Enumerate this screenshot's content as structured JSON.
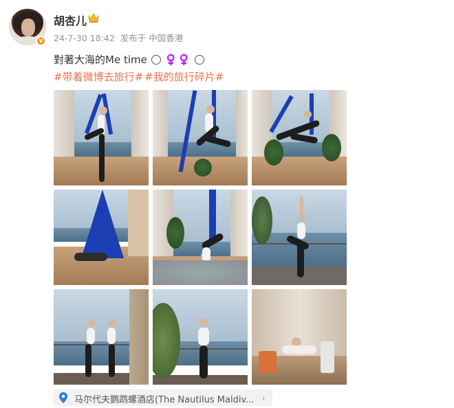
{
  "user": {
    "name": "胡杏儿",
    "timestamp": "24-7-30 18:42",
    "source": "发布于 中国香港",
    "verified_color": "#f7931e"
  },
  "post": {
    "text": "對著大海的Me time",
    "text_suffix": "♀️♀️",
    "hashtags": [
      "#带着微博去旅行#",
      "#我的旅行碎片#"
    ],
    "hashtag_color": "#eb7350"
  },
  "photos": [
    {
      "label": ""
    },
    {
      "label": ""
    },
    {
      "label": ""
    },
    {
      "label": ""
    },
    {
      "label": ""
    },
    {
      "label": ""
    },
    {
      "label": ""
    },
    {
      "label": ""
    },
    {
      "label": ""
    }
  ],
  "location": {
    "text": "马尔代夫鹦鹉螺酒店(The Nautilus Maldiv...",
    "icon": "pin-icon",
    "accent": "#2b7fd6"
  }
}
